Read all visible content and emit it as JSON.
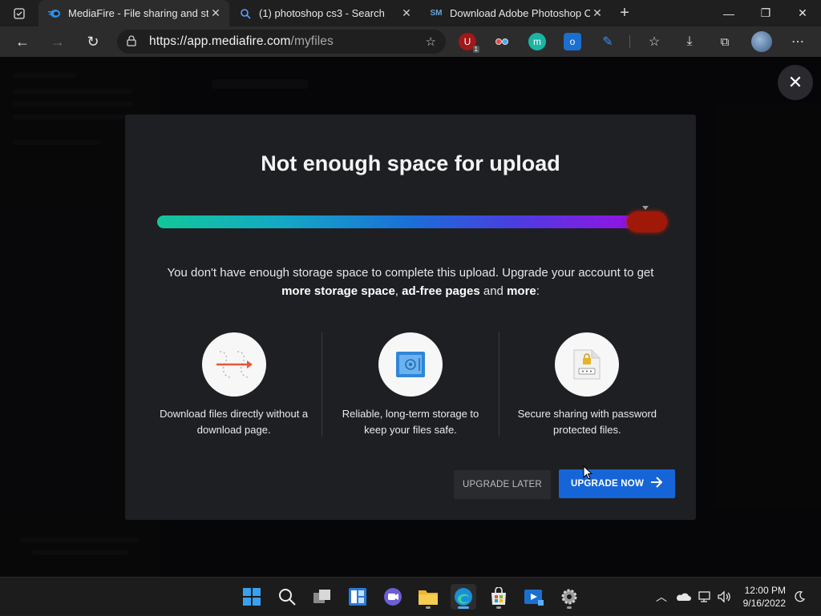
{
  "browser": {
    "tabs": [
      {
        "title": "MediaFire - File sharing and stor",
        "favicon": "mediafire-icon",
        "active": true
      },
      {
        "title": "(1) photoshop cs3 - Search",
        "favicon": "search-icon",
        "active": false
      },
      {
        "title": "Download Adobe Photoshop CS",
        "favicon": "SM",
        "active": false
      }
    ],
    "url_host": "https://app.mediafire.com",
    "url_path": "/myfiles",
    "extension_badge": "1"
  },
  "modal": {
    "title": "Not enough space for upload",
    "description_line1": "You don't have enough storage space to complete this upload. Upgrade your account to get",
    "desc_bold1": "more storage space",
    "desc_sep1": ", ",
    "desc_bold2": "ad-free pages",
    "desc_and": " and ",
    "desc_bold3": "more",
    "desc_end": ":",
    "features": [
      {
        "icon": "direct-download-icon",
        "text": "Download files directly without a download page."
      },
      {
        "icon": "safe-storage-icon",
        "text": "Reliable, long-term storage to keep your files safe."
      },
      {
        "icon": "password-file-icon",
        "text": "Secure sharing with password protected files."
      }
    ],
    "btn_later": "UPGRADE LATER",
    "btn_now": "UPGRADE NOW",
    "storage_usage_fraction": 1.0
  },
  "taskbar": {
    "time": "12:00 PM",
    "date": "9/16/2022"
  },
  "colors": {
    "primary_button": "#1565d8",
    "over_limit": "#a01808"
  }
}
